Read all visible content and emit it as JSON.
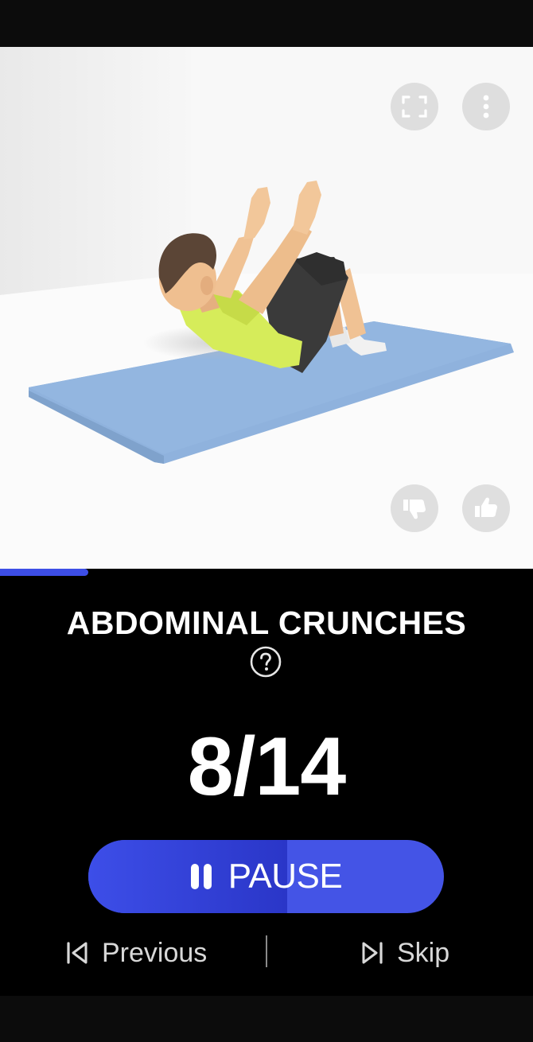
{
  "exercise": {
    "name": "ABDOMINAL CRUNCHES",
    "counter": "8/14",
    "progress_fraction": 0.166
  },
  "controls": {
    "pause_label": "PAUSE",
    "pause_progress_fraction": 0.56,
    "previous_label": "Previous",
    "skip_label": "Skip"
  },
  "colors": {
    "accent": "#3d4ee6",
    "background": "#000000",
    "mat": "#8fb2dd",
    "shirt": "#d6ec5a"
  },
  "icons": {
    "fullscreen": "fullscreen-icon",
    "more": "more-vertical-icon",
    "dislike": "thumbs-down-icon",
    "like": "thumbs-up-icon",
    "help": "help-circle-icon",
    "pause": "pause-icon",
    "previous": "skip-previous-icon",
    "skip": "skip-next-icon"
  }
}
